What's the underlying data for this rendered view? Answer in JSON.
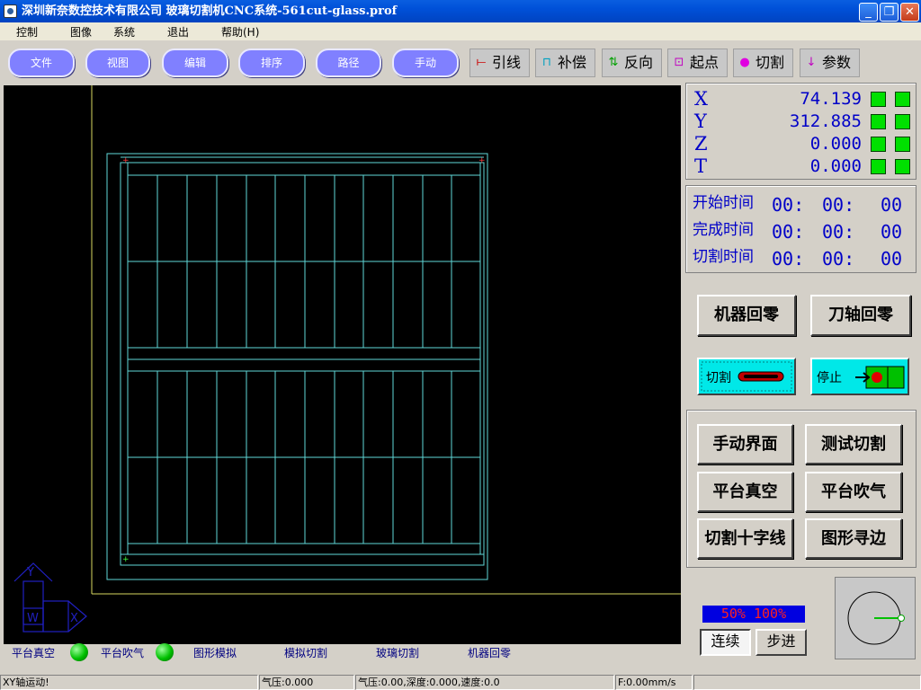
{
  "window": {
    "title": "深圳新奈数控技术有限公司 玻璃切割机CNC系统-561cut-glass.prof",
    "minimize": "_",
    "restore": "❐",
    "close": "✕"
  },
  "menu": [
    "控制",
    "图像",
    "系统",
    "退出",
    "帮助(H)"
  ],
  "toolbar": {
    "pills": [
      "文件",
      "视图",
      "编辑",
      "排序",
      "路径",
      "手动"
    ],
    "tools": [
      {
        "label": "引线",
        "icon": "lead-line-icon"
      },
      {
        "label": "补偿",
        "icon": "compensation-icon"
      },
      {
        "label": "反向",
        "icon": "reverse-icon"
      },
      {
        "label": "起点",
        "icon": "start-point-icon"
      },
      {
        "label": "切割",
        "icon": "cut-icon"
      },
      {
        "label": "参数",
        "icon": "parameters-icon"
      }
    ]
  },
  "coords": [
    {
      "axis": "X",
      "value": "74.139"
    },
    {
      "axis": "Y",
      "value": "312.885"
    },
    {
      "axis": "Z",
      "value": "0.000"
    },
    {
      "axis": "T",
      "value": "0.000"
    }
  ],
  "times": [
    {
      "label": "开始时间",
      "h": "00:",
      "m": "00:",
      "s": "00"
    },
    {
      "label": "完成时间",
      "h": "00:",
      "m": "00:",
      "s": "00"
    },
    {
      "label": "切割时间",
      "h": "00:",
      "m": "00:",
      "s": "00"
    }
  ],
  "buttons": {
    "machine_home": "机器回零",
    "tool_home": "刀轴回零",
    "cut": "切割",
    "stop": "停止",
    "manual": "手动界面",
    "test_cut": "测试切割",
    "vacuum": "平台真空",
    "blow": "平台吹气",
    "crosshair": "切割十字线",
    "edge_find": "图形寻边",
    "continuous": "连续",
    "step": "步进"
  },
  "speed": {
    "a": "50%",
    "b": "100%"
  },
  "status_row": {
    "vacuum": "平台真空",
    "blow": "平台吹气",
    "sim": "图形模拟",
    "sim_cut": "模拟切割",
    "glass_cut": "玻璃切割",
    "machine_home": "机器回零"
  },
  "axis_labels": {
    "y": "Y",
    "w": "W",
    "x": "X"
  },
  "statusbar": [
    "XY轴运动!",
    "气压:0.000",
    "气压:0.00,深度:0.000,速度:0.0",
    "F:0.00mm/s",
    ""
  ],
  "colors": {
    "accent": "#0000c8",
    "led": "#00c000",
    "cyan": "#00e8e8",
    "pill": "#8080ff",
    "canvas": "#000000",
    "figure": "#5fd7d7"
  }
}
